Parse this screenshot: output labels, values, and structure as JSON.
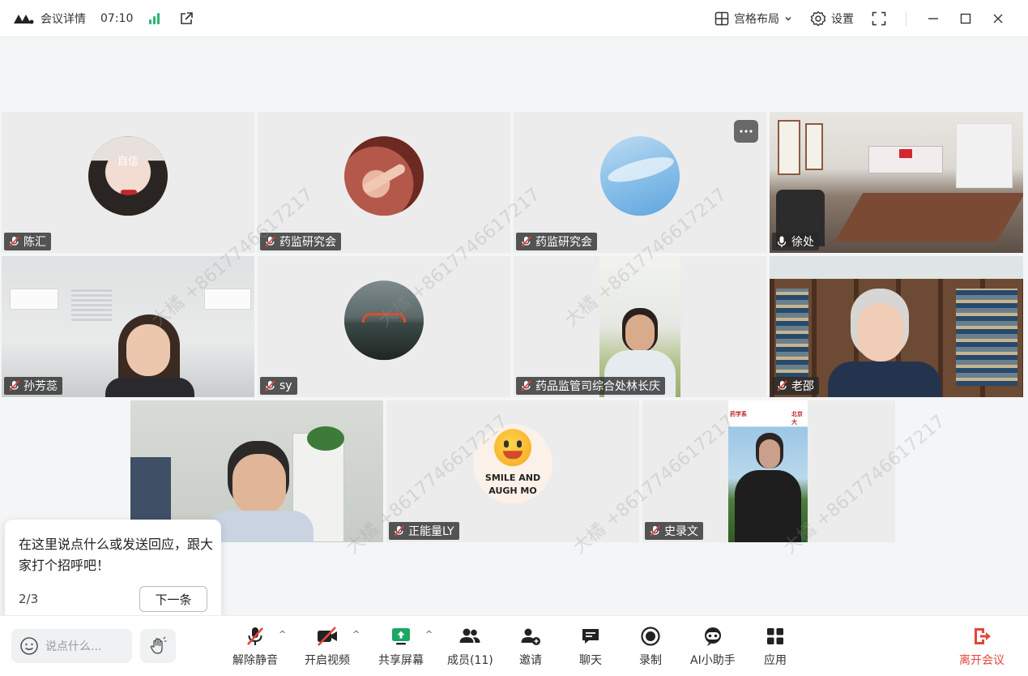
{
  "topbar": {
    "meeting_details": "会议详情",
    "time": "07:10",
    "layout_label": "宫格布局",
    "settings_label": "设置"
  },
  "colors": {
    "accent": "#2bc18c",
    "danger": "#e4453a",
    "signal": "#2bb673"
  },
  "watermark": "大橘 +8617746617217",
  "tiles": [
    {
      "name": "陈汇",
      "type": "avatar",
      "muted": true
    },
    {
      "name": "药监研究会",
      "type": "avatar",
      "muted": true
    },
    {
      "name": "药监研究会",
      "type": "avatar",
      "muted": true
    },
    {
      "name": "徐处",
      "type": "video",
      "muted": false,
      "active": true
    },
    {
      "name": "孙芳蕊",
      "type": "video",
      "muted": true
    },
    {
      "name": "sy",
      "type": "avatar",
      "muted": true
    },
    {
      "name": "药品监管司综合处林长庆",
      "type": "video",
      "muted": true
    },
    {
      "name": "老邵",
      "type": "video",
      "muted": true
    },
    {
      "name": "",
      "type": "video",
      "muted": false
    },
    {
      "name": "正能量LY",
      "type": "avatar",
      "muted": true
    },
    {
      "name": "史录文",
      "type": "video",
      "muted": true
    }
  ],
  "smile_text_1": "SMILE AND",
  "smile_text_2": "AUGH MO",
  "avatar_caption": "自信",
  "banner_left": "药学系",
  "banner_right": "北京大",
  "tip": {
    "text": "在这里说点什么或发送回应，跟大家打个招呼吧！",
    "page": "2/3",
    "next_label": "下一条"
  },
  "bottombar": {
    "say_placeholder": "说点什么...",
    "unmute": "解除静音",
    "start_video": "开启视频",
    "share_screen": "共享屏幕",
    "members": "成员(11)",
    "invite": "邀请",
    "chat": "聊天",
    "record": "录制",
    "ai_assistant": "AI小助手",
    "apps": "应用",
    "leave": "离开会议"
  }
}
